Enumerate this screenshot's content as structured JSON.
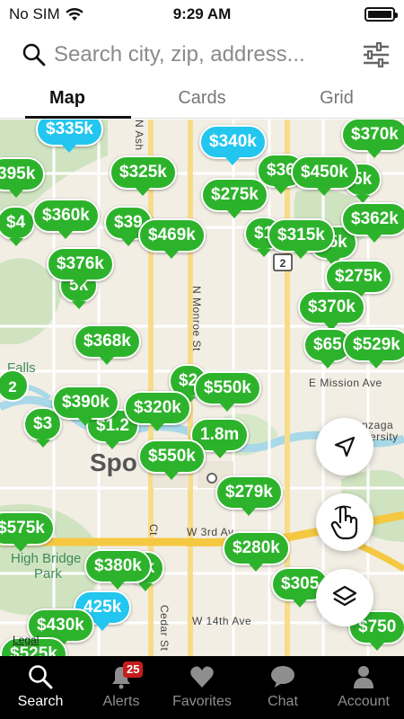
{
  "status_bar": {
    "carrier": "No SIM",
    "time": "9:29 AM"
  },
  "search": {
    "placeholder": "Search city, zip, address..."
  },
  "tabs": [
    {
      "label": "Map",
      "active": true
    },
    {
      "label": "Cards",
      "active": false
    },
    {
      "label": "Grid",
      "active": false
    }
  ],
  "map": {
    "city_label": "Spo",
    "park_label_1": "High Bridge",
    "park_label_2": "Park",
    "falls_label": "Falls",
    "university_label_1": "Gonzaga",
    "university_label_2": "University",
    "legal": "Legal",
    "streets": {
      "ash": "N Ash",
      "monroe": "N Monroe St",
      "mission": "E Mission Ave",
      "third": "W 3rd Av",
      "fourteenth": "W 14th Ave",
      "cedar": "Cedar St",
      "sixth": "Ct"
    },
    "cluster_count": "2",
    "pins": [
      {
        "label": "$335k",
        "color": "blue"
      },
      {
        "label": "$340k",
        "color": "blue"
      },
      {
        "label": "$370k",
        "color": "green"
      },
      {
        "label": "395k",
        "color": "green"
      },
      {
        "label": "$325k",
        "color": "green"
      },
      {
        "label": "$36",
        "color": "green"
      },
      {
        "label": "$450k",
        "color": "green"
      },
      {
        "label": "5k",
        "color": "green"
      },
      {
        "label": "$275k",
        "color": "green"
      },
      {
        "label": "$4",
        "color": "green"
      },
      {
        "label": "$360k",
        "color": "green"
      },
      {
        "label": "$39",
        "color": "green"
      },
      {
        "label": "$469k",
        "color": "green"
      },
      {
        "label": "$1",
        "color": "green"
      },
      {
        "label": "$315k",
        "color": "green"
      },
      {
        "label": "65k",
        "color": "green"
      },
      {
        "label": "$362k",
        "color": "green"
      },
      {
        "label": "$376k",
        "color": "green"
      },
      {
        "label": "5k",
        "color": "green"
      },
      {
        "label": "$275k",
        "color": "green"
      },
      {
        "label": "$370k",
        "color": "green"
      },
      {
        "label": "$368k",
        "color": "green"
      },
      {
        "label": "$65",
        "color": "green"
      },
      {
        "label": "$529k",
        "color": "green"
      },
      {
        "label": "$2",
        "color": "green"
      },
      {
        "label": "$550k",
        "color": "green"
      },
      {
        "label": "$390k",
        "color": "green"
      },
      {
        "label": "$320k",
        "color": "green"
      },
      {
        "label": "$3",
        "color": "green"
      },
      {
        "label": "$1.2",
        "color": "green"
      },
      {
        "label": "1.8m",
        "color": "green"
      },
      {
        "label": "$550k",
        "color": "green"
      },
      {
        "label": "$279k",
        "color": "green"
      },
      {
        "label": "$575k",
        "color": "green"
      },
      {
        "label": "$280k",
        "color": "green"
      },
      {
        "label": "0k",
        "color": "green"
      },
      {
        "label": "$380k",
        "color": "green"
      },
      {
        "label": "$305",
        "color": "green"
      },
      {
        "label": "425k",
        "color": "blue"
      },
      {
        "label": "$430k",
        "color": "green"
      },
      {
        "label": "$750",
        "color": "green"
      },
      {
        "label": "$525k",
        "color": "green"
      }
    ]
  },
  "bottom_nav": [
    {
      "label": "Search",
      "icon": "search-icon",
      "active": true
    },
    {
      "label": "Alerts",
      "icon": "bell-icon",
      "badge": "25"
    },
    {
      "label": "Favorites",
      "icon": "heart-icon"
    },
    {
      "label": "Chat",
      "icon": "chat-bubble-icon"
    },
    {
      "label": "Account",
      "icon": "person-icon"
    }
  ],
  "colors": {
    "pin_green": "#2db32b",
    "pin_blue": "#22c6ee",
    "nav_bg": "#000000",
    "badge": "#c51d1d"
  }
}
